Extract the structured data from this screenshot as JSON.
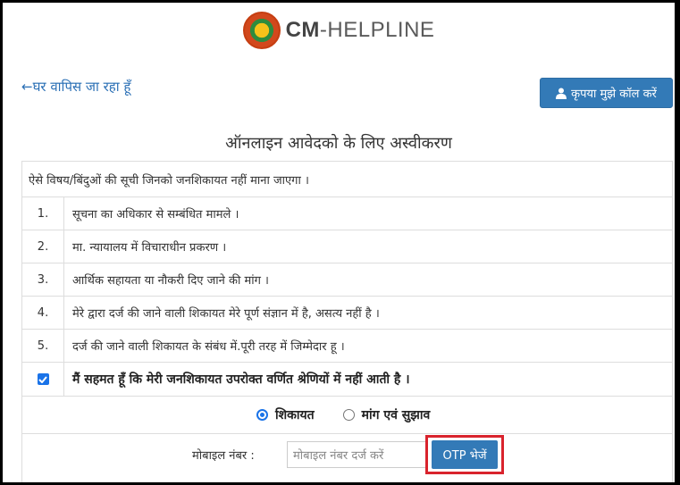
{
  "header": {
    "brand_strong": "CM",
    "brand_rest": "-HELPLINE"
  },
  "nav": {
    "back_label": "←घर वापिस जा रहा हूँ",
    "call_button": "कृपया मुझे कॉल करें"
  },
  "title": "ऑनलाइन आवेदको के लिए अस्वीकरण",
  "list": {
    "intro": "ऐसे विषय/बिंदुओं की सूची जिनको जनशिकायत नहीं माना जाएगा ।",
    "items": [
      {
        "num": "1.",
        "text": "सूचना का अधिकार से सम्बंधित मामले ।"
      },
      {
        "num": "2.",
        "text": "मा. न्यायालय में विचाराधीन प्रकरण ।"
      },
      {
        "num": "3.",
        "text": "आर्थिक सहायता या नौकरी दिए जाने की मांग ।"
      },
      {
        "num": "4.",
        "text": "मेरे द्वारा दर्ज की जाने वाली शिकायत मेरे पूर्ण संज्ञान में है, असत्य नहीं है ।"
      },
      {
        "num": "5.",
        "text": "दर्ज की जाने वाली शिकायत के संबंध में.पूरी तरह में जिम्मेदार हू ।"
      }
    ]
  },
  "agreement": {
    "text": "मैं सहमत हूँ कि मेरी जनशिकायत उपरोक्त वर्णित श्रेणियों में नहीं आती है ।",
    "checked": true
  },
  "type_options": [
    {
      "label": "शिकायत",
      "selected": true
    },
    {
      "label": "मांग एवं सुझाव",
      "selected": false
    }
  ],
  "mobile": {
    "label": "मोबाइल नंबर :",
    "placeholder": "मोबाइल नंबर दर्ज करें",
    "value": ""
  },
  "otp_button": "OTP भेजें",
  "colors": {
    "primary": "#337ab7",
    "highlight": "#d9232d",
    "link": "#2a6fb5"
  }
}
